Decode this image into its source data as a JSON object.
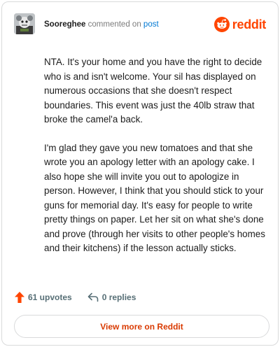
{
  "header": {
    "username": "Sooreghee",
    "commented_text": "commented on",
    "post_link": "post",
    "brand_wordmark": "reddit",
    "brand_color": "#ff4500"
  },
  "comment": {
    "paragraphs": [
      "NTA. It's your home and you have the right to decide who is and isn't welcome. Your sil has displayed on numerous occasions that she doesn't respect boundaries. This event was just the 40lb straw that broke the camel'a back.",
      "I'm glad they gave you new tomatoes and that she wrote you an apology letter with an apology cake. I also hope she will invite you out to apologize in person. However, I think that you should stick to your guns for memorial day. It's easy for people to write pretty things on paper. Let her sit on what she's done and prove (through her visits to other people's homes and their kitchens) if the lesson actually sticks."
    ]
  },
  "actions": {
    "upvotes_label": "61 upvotes",
    "replies_label": "0 replies",
    "upvote_icon": "upvote-arrow-icon",
    "reply_icon": "reply-arrow-icon",
    "upvote_color": "#ff4500"
  },
  "footer": {
    "view_more_label": "View more on Reddit",
    "view_more_color": "#d93a00"
  }
}
